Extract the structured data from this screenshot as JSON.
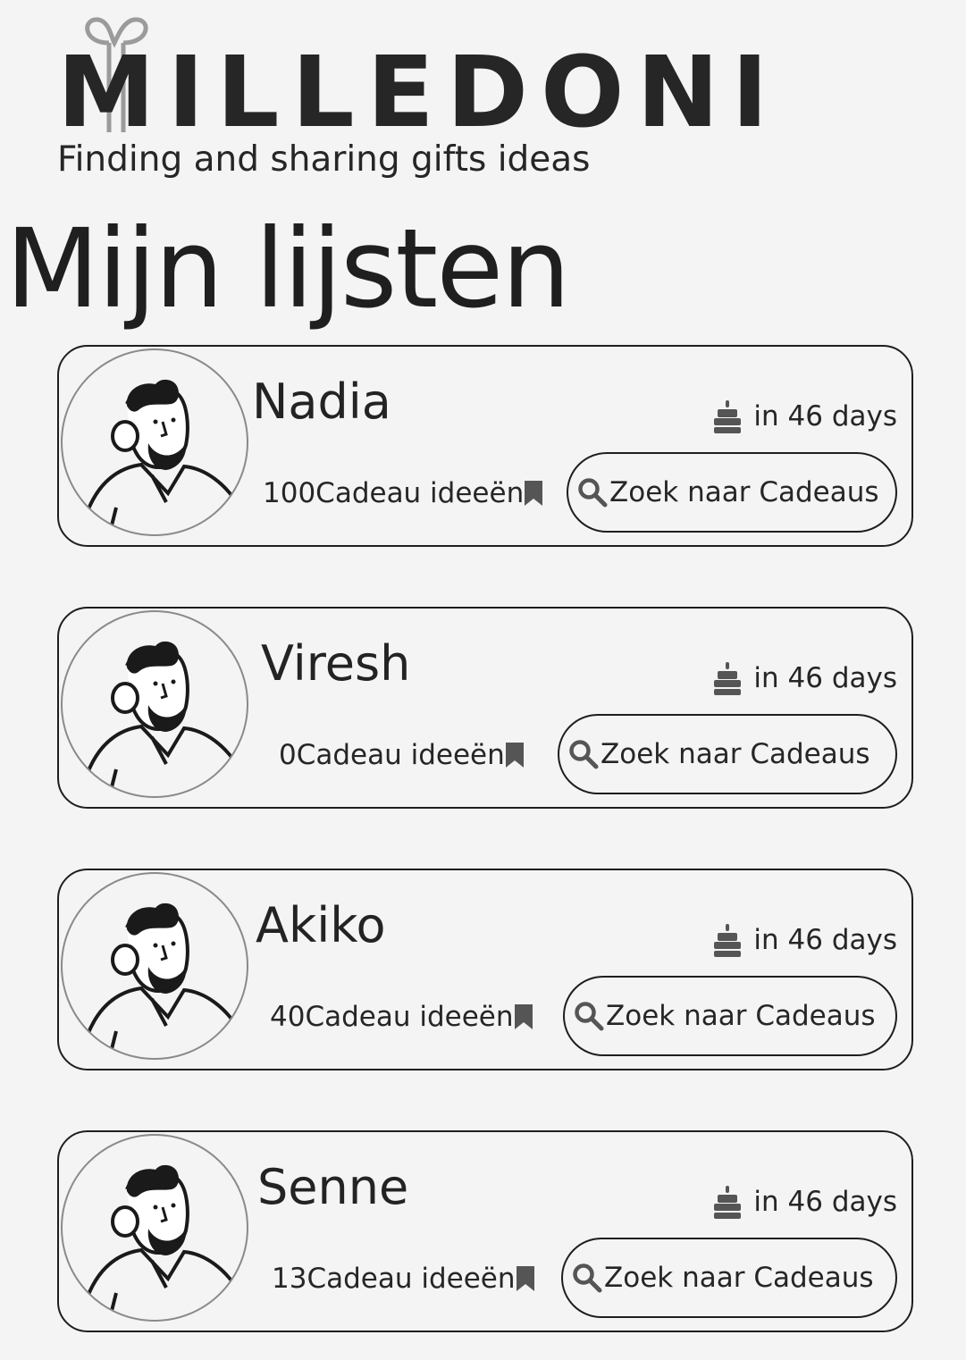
{
  "header": {
    "logo_text": "MILLEDONI",
    "tagline": "Finding and sharing gifts ideas"
  },
  "page_title": "Mijn lijsten",
  "lists": [
    {
      "name": "Nadia",
      "birthday": "in 46 days",
      "idea_count": "100",
      "ideas_label": "Cadeau ideeën",
      "search_label": "Zoek naar Cadeaus"
    },
    {
      "name": "Viresh",
      "birthday": "in 46 days",
      "idea_count": "0",
      "ideas_label": "Cadeau ideeën",
      "search_label": "Zoek naar Cadeaus"
    },
    {
      "name": "Akiko",
      "birthday": "in 46 days",
      "idea_count": "40",
      "ideas_label": "Cadeau ideeën",
      "search_label": "Zoek naar Cadeaus"
    },
    {
      "name": "Senne",
      "birthday": "in 46 days",
      "idea_count": "13",
      "ideas_label": "Cadeau ideeën",
      "search_label": "Zoek naar Cadeaus"
    }
  ],
  "icons": {
    "birthday": "birthday-cake-icon",
    "ideas": "bookmark-icon",
    "search": "search-icon",
    "logo_bow": "gift-bow-icon",
    "avatar": "avatar-illustration"
  },
  "colors": {
    "background": "#f4f4f4",
    "text": "#262626",
    "icon": "#555555",
    "logo_bow": "#9b9b9b"
  }
}
